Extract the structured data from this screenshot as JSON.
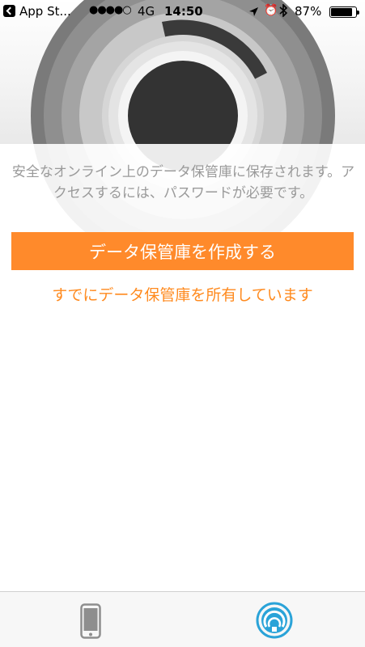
{
  "status_bar": {
    "carrier": "App St...",
    "signal_dots": "●●●●○",
    "network": "4G",
    "time": "14:50",
    "battery_percent": "87%",
    "battery_level": 0.87,
    "icons": [
      "back-arrow-icon",
      "location-arrow-icon",
      "alarm-clock-icon",
      "bluetooth-icon",
      "battery-icon"
    ]
  },
  "main": {
    "description": "安全なオンライン上のデータ保管庫に保存されます。アクセスするには、パスワードが必要です。",
    "create_button_label": "データ保管庫を作成する",
    "already_have_link": "すでにデータ保管庫を所有しています"
  },
  "tab_bar": {
    "tabs": [
      {
        "icon": "smartphone-icon",
        "selected": false
      },
      {
        "icon": "vault-signal-icon",
        "selected": true
      }
    ]
  },
  "colors": {
    "accent": "#ff8a2b",
    "link": "#ff8a1e",
    "description_text": "#9a9a9a",
    "tab_active": "#2aa3d8",
    "tab_inactive": "#8e8e8e"
  }
}
